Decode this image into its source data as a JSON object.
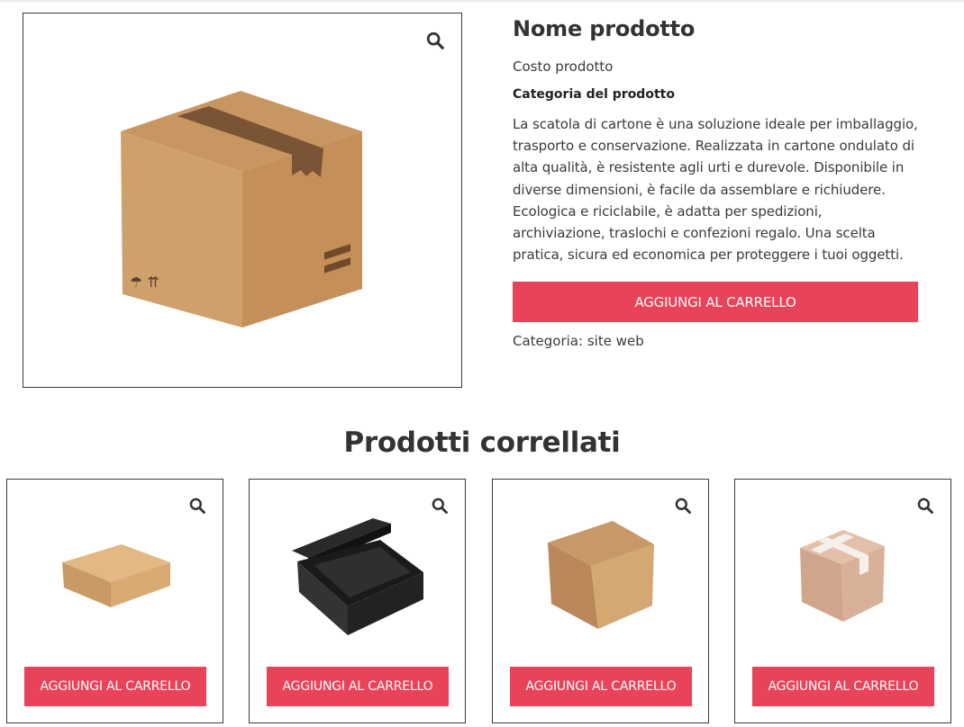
{
  "product": {
    "title": "Nome prodotto",
    "price": "Costo prodotto",
    "category_heading": "Categoria del prodotto",
    "description": "La scatola di cartone è una soluzione ideale per imballaggio, trasporto e conservazione. Realizzata in cartone ondulato di alta qualità, è resistente agli urti e durevole. Disponibile in diverse dimensioni, è facile da assemblare e richiudere. Ecologica e riciclabile, è adatta per spedizioni, archiviazione, traslochi e confezioni regalo. Una scelta pratica, sicura ed economica per proteggere i tuoi oggetti.",
    "add_to_cart_label": "AGGIUNGI AL CARRELLO",
    "meta_label": "Categoria:",
    "meta_value": "site web",
    "image_icon": "cardboard-box-image",
    "zoom_icon": "search-icon"
  },
  "related": {
    "title": "Prodotti correllati",
    "items": [
      {
        "image_icon": "flat-kraft-box-image",
        "button_label": "AGGIUNGI AL CARRELLO"
      },
      {
        "image_icon": "black-open-box-image",
        "button_label": "AGGIUNGI AL CARRELLO"
      },
      {
        "image_icon": "cube-kraft-box-image",
        "button_label": "AGGIUNGI AL CARRELLO"
      },
      {
        "image_icon": "taped-box-image",
        "button_label": "AGGIUNGI AL CARRELLO"
      }
    ]
  },
  "colors": {
    "accent": "#e9435a",
    "text": "#3a3a3a",
    "cardboard": "#d0a06c"
  }
}
